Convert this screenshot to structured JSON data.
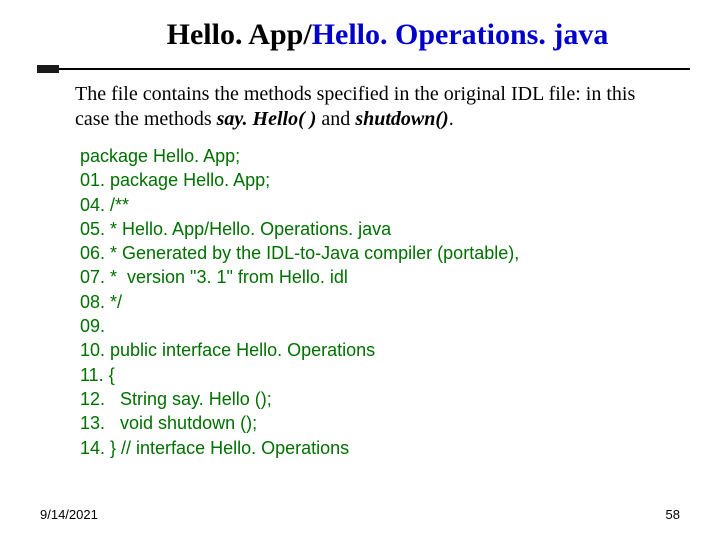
{
  "title": {
    "part1": "Hello. App/",
    "part2": "Hello. Operations. java"
  },
  "desc": {
    "t1": "The file contains the methods specified in the original IDL file: in this case the methods ",
    "m1": "say. Hello( )",
    "t2": " and ",
    "m2": "shutdown()",
    "t3": "."
  },
  "code": [
    "package Hello. App;",
    "01. package Hello. App;",
    "04. /**",
    "05. * Hello. App/Hello. Operations. java",
    "06. * Generated by the IDL-to-Java compiler (portable),",
    "07. *  version \"3. 1\" from Hello. idl",
    "08. */",
    "09.",
    "10. public interface Hello. Operations",
    "11. {",
    "12.   String say. Hello ();",
    "13.   void shutdown ();",
    "14. } // interface Hello. Operations"
  ],
  "footer": {
    "date": "9/14/2021",
    "page": "58"
  }
}
